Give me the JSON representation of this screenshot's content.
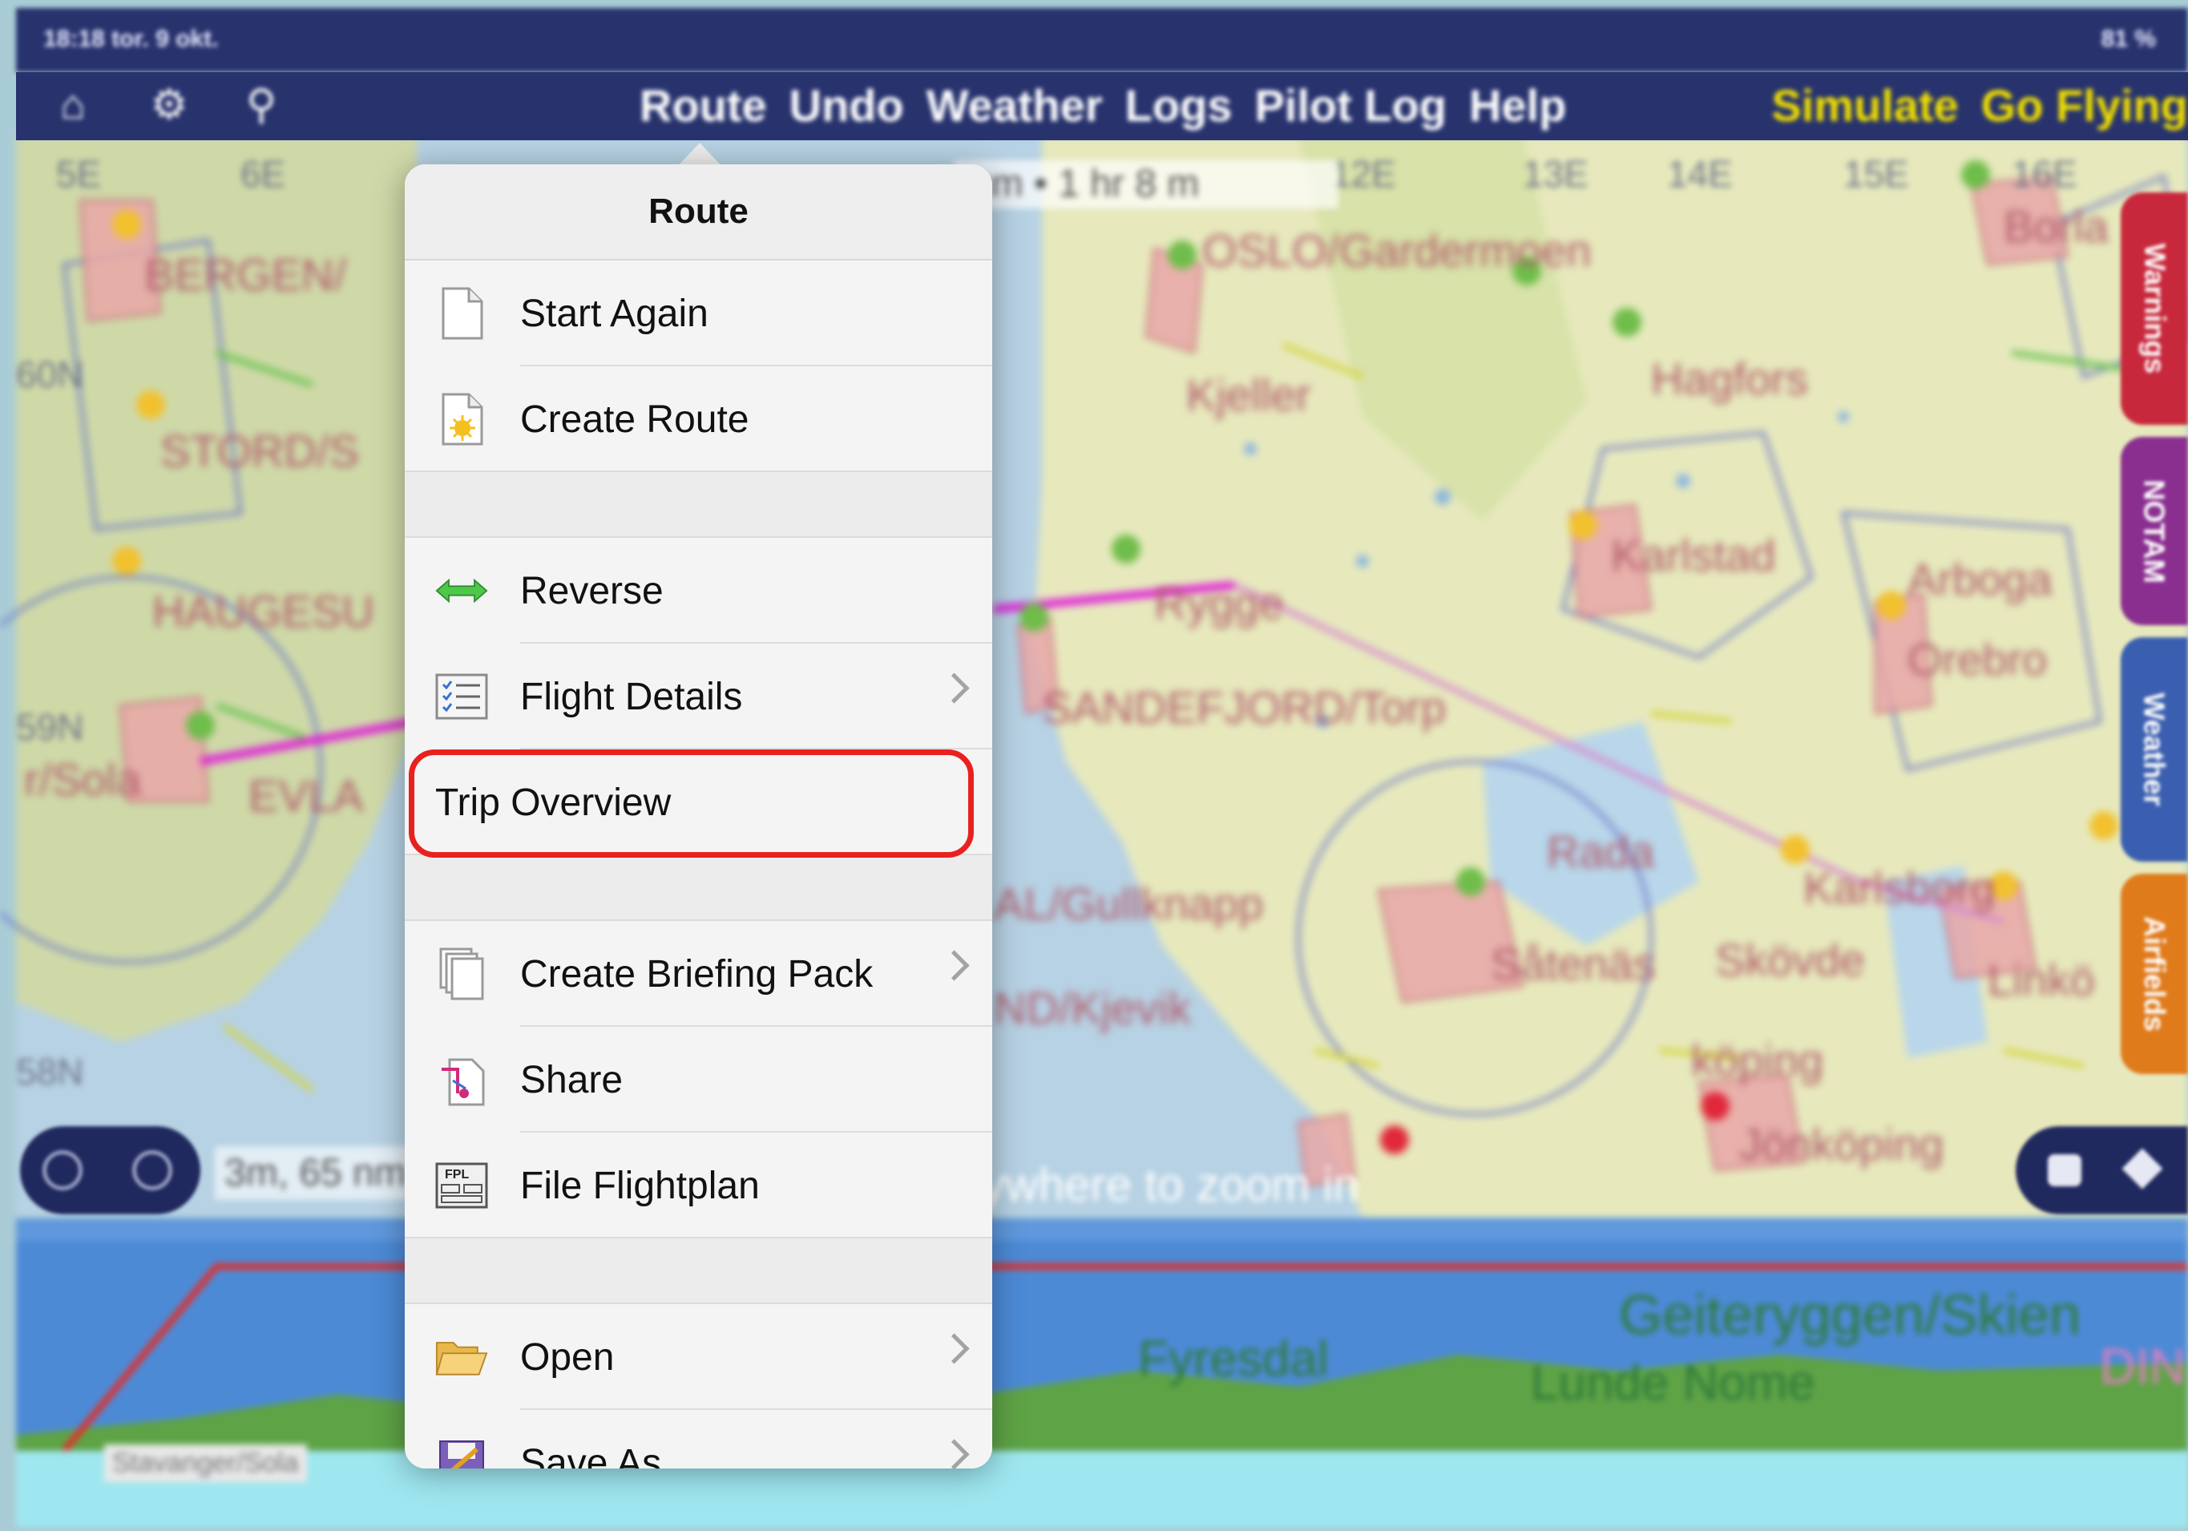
{
  "status_bar": {
    "time": "18:18 tor. 9 okt.",
    "right": "81 %"
  },
  "top_nav": {
    "icons": [
      "home-icon",
      "gear-icon",
      "search-icon"
    ],
    "menu": [
      "Route",
      "Undo",
      "Weather",
      "Logs",
      "Pilot Log",
      "Help"
    ],
    "right_buttons": [
      "Simulate",
      "Go Flying"
    ],
    "colors": {
      "bar": "#28336e",
      "menu_text": "#ffffff",
      "right_text": "#f2e100"
    }
  },
  "map": {
    "route_summary": "nm • 1 hr 8 m",
    "scale_text": "3m, 65 nm",
    "hint": "ywhere to zoom in",
    "labels": [
      "BERGEN/",
      "STORD/S",
      "HAUGESU",
      "r/Sola",
      "EVLA",
      "OSLO/Gardermoen",
      "Kjeller",
      "Hagfors",
      "Karlstad",
      "Arboga",
      "Orebro",
      "Rygge",
      "SANDEFJORD/Torp",
      "AL/Gullknapp",
      "ND/Kjevik",
      "Rada",
      "Såtenäs",
      "Skövde",
      "Karlsborg",
      "Jönköping",
      "Linkö",
      "köping",
      "Borla"
    ],
    "lat_labels": [
      "5E",
      "6E",
      "60N",
      "59N",
      "58N",
      "12E",
      "13E",
      "14E",
      "15E",
      "16E"
    ],
    "side_tabs": [
      {
        "label": "Warnings",
        "color": "#c8283c"
      },
      {
        "label": "NOTAM",
        "color": "#8a2f8f"
      },
      {
        "label": "Weather",
        "color": "#3b5fb0"
      },
      {
        "label": "Airfields",
        "color": "#e07b1c"
      }
    ]
  },
  "profile": {
    "labels": [
      "Geiteryggen/Skien",
      "Lunde Nome",
      "Fyresdal",
      "Stavanger/Sola",
      "DIN"
    ]
  },
  "popover": {
    "title": "Route",
    "groups": [
      [
        {
          "label": "Start Again",
          "icon": "blank-document-icon",
          "chevron": false
        },
        {
          "label": "Create Route",
          "icon": "new-document-icon",
          "chevron": false
        }
      ],
      [
        {
          "label": "Reverse",
          "icon": "reverse-arrows-icon",
          "chevron": false
        },
        {
          "label": "Flight Details",
          "icon": "checklist-icon",
          "chevron": true
        },
        {
          "label": "Trip Overview",
          "icon": "",
          "chevron": false,
          "highlighted": true
        }
      ],
      [
        {
          "label": "Create Briefing Pack",
          "icon": "documents-stack-icon",
          "chevron": true
        },
        {
          "label": "Share",
          "icon": "share-document-icon",
          "chevron": false
        },
        {
          "label": "File Flightplan",
          "icon": "fpl-form-icon",
          "chevron": false
        }
      ],
      [
        {
          "label": "Open",
          "icon": "folder-open-icon",
          "chevron": true
        },
        {
          "label": "Save As",
          "icon": "save-as-icon",
          "chevron": true
        }
      ]
    ],
    "highlight_color": "#e8211f"
  }
}
